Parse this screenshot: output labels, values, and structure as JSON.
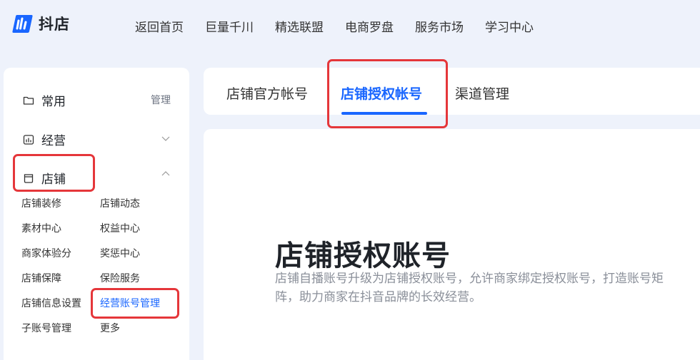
{
  "brand": {
    "name": "抖店",
    "color": "#1966ff"
  },
  "top_nav": [
    "返回首页",
    "巨量千川",
    "精选联盟",
    "电商罗盘",
    "服务市场",
    "学习中心"
  ],
  "sidebar": {
    "groups": [
      {
        "label": "常用",
        "icon": "folder-icon",
        "aux": "管理"
      },
      {
        "label": "经营",
        "icon": "chart-icon",
        "state": "collapsed"
      },
      {
        "label": "店铺",
        "icon": "shop-icon",
        "state": "expanded"
      }
    ],
    "shop_items": [
      "店铺装修",
      "店铺动态",
      "素材中心",
      "权益中心",
      "商家体验分",
      "奖惩中心",
      "店铺保障",
      "保险服务",
      "店铺信息设置",
      "经营账号管理",
      "子账号管理",
      "更多"
    ],
    "active_item": "经营账号管理"
  },
  "tabs": {
    "items": [
      "店铺官方帐号",
      "店铺授权帐号",
      "渠道管理"
    ],
    "active": "店铺授权帐号"
  },
  "content": {
    "title": "店铺授权账号",
    "description": "店铺自播账号升级为店铺授权账号，允许商家绑定授权账号，打造账号矩阵，助力商家在抖音品牌的长效经营。"
  },
  "colors": {
    "highlight_box": "#e5363a",
    "active_text": "#1966ff",
    "page_bg": "#eef2fb"
  }
}
